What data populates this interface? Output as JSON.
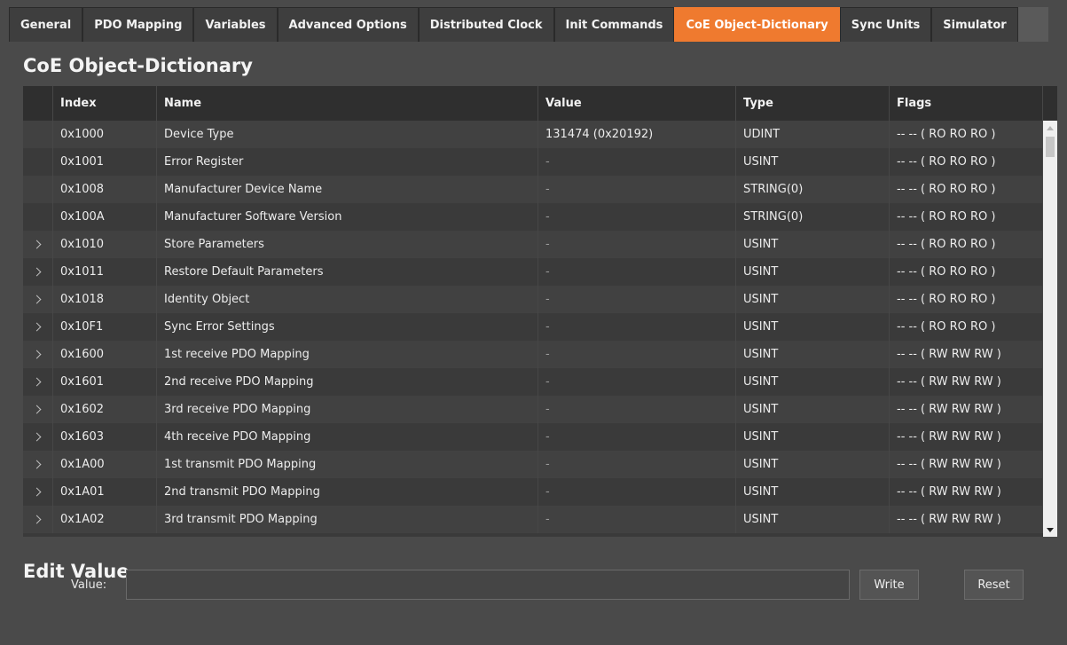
{
  "tabs": [
    {
      "label": "General",
      "active": false
    },
    {
      "label": "PDO Mapping",
      "active": false
    },
    {
      "label": "Variables",
      "active": false
    },
    {
      "label": "Advanced Options",
      "active": false
    },
    {
      "label": "Distributed Clock",
      "active": false
    },
    {
      "label": "Init Commands",
      "active": false
    },
    {
      "label": "CoE Object-Dictionary",
      "active": true
    },
    {
      "label": "Sync Units",
      "active": false
    },
    {
      "label": "Simulator",
      "active": false
    }
  ],
  "colors": {
    "accent": "#ef7a2f",
    "background": "#4a4a4a",
    "grid": "#3a3a3a",
    "header": "#2f2f2f"
  },
  "dictionary": {
    "title": "CoE Object-Dictionary",
    "columns": {
      "index": "Index",
      "name": "Name",
      "value": "Value",
      "type": "Type",
      "flags": "Flags"
    },
    "rows": [
      {
        "expandable": false,
        "index": "0x1000",
        "name": "Device Type",
        "value": "131474 (0x20192)",
        "type": "UDINT",
        "flags": "-- -- ( RO RO RO )"
      },
      {
        "expandable": false,
        "index": "0x1001",
        "name": "Error Register",
        "value": "-",
        "type": "USINT",
        "flags": "-- -- ( RO RO RO )"
      },
      {
        "expandable": false,
        "index": "0x1008",
        "name": "Manufacturer Device Name",
        "value": "-",
        "type": "STRING(0)",
        "flags": "-- -- ( RO RO RO )"
      },
      {
        "expandable": false,
        "index": "0x100A",
        "name": "Manufacturer Software Version",
        "value": "-",
        "type": "STRING(0)",
        "flags": "-- -- ( RO RO RO )"
      },
      {
        "expandable": true,
        "index": "0x1010",
        "name": "Store Parameters",
        "value": "-",
        "type": "USINT",
        "flags": "-- -- ( RO RO RO )"
      },
      {
        "expandable": true,
        "index": "0x1011",
        "name": "Restore Default Parameters",
        "value": "-",
        "type": "USINT",
        "flags": "-- -- ( RO RO RO )"
      },
      {
        "expandable": true,
        "index": "0x1018",
        "name": "Identity Object",
        "value": "-",
        "type": "USINT",
        "flags": "-- -- ( RO RO RO )"
      },
      {
        "expandable": true,
        "index": "0x10F1",
        "name": "Sync Error Settings",
        "value": "-",
        "type": "USINT",
        "flags": "-- -- ( RO RO RO )"
      },
      {
        "expandable": true,
        "index": "0x1600",
        "name": "1st receive PDO Mapping",
        "value": "-",
        "type": "USINT",
        "flags": "-- -- ( RW RW RW )"
      },
      {
        "expandable": true,
        "index": "0x1601",
        "name": "2nd receive PDO Mapping",
        "value": "-",
        "type": "USINT",
        "flags": "-- -- ( RW RW RW )"
      },
      {
        "expandable": true,
        "index": "0x1602",
        "name": "3rd receive PDO Mapping",
        "value": "-",
        "type": "USINT",
        "flags": "-- -- ( RW RW RW )"
      },
      {
        "expandable": true,
        "index": "0x1603",
        "name": "4th receive PDO Mapping",
        "value": "-",
        "type": "USINT",
        "flags": "-- -- ( RW RW RW )"
      },
      {
        "expandable": true,
        "index": "0x1A00",
        "name": "1st transmit PDO Mapping",
        "value": "-",
        "type": "USINT",
        "flags": "-- -- ( RW RW RW )"
      },
      {
        "expandable": true,
        "index": "0x1A01",
        "name": "2nd transmit PDO Mapping",
        "value": "-",
        "type": "USINT",
        "flags": "-- -- ( RW RW RW )"
      },
      {
        "expandable": true,
        "index": "0x1A02",
        "name": "3rd transmit PDO Mapping",
        "value": "-",
        "type": "USINT",
        "flags": "-- -- ( RW RW RW )"
      }
    ]
  },
  "edit": {
    "title": "Edit Value",
    "value_label": "Value:",
    "value": "",
    "write_label": "Write",
    "reset_label": "Reset"
  }
}
